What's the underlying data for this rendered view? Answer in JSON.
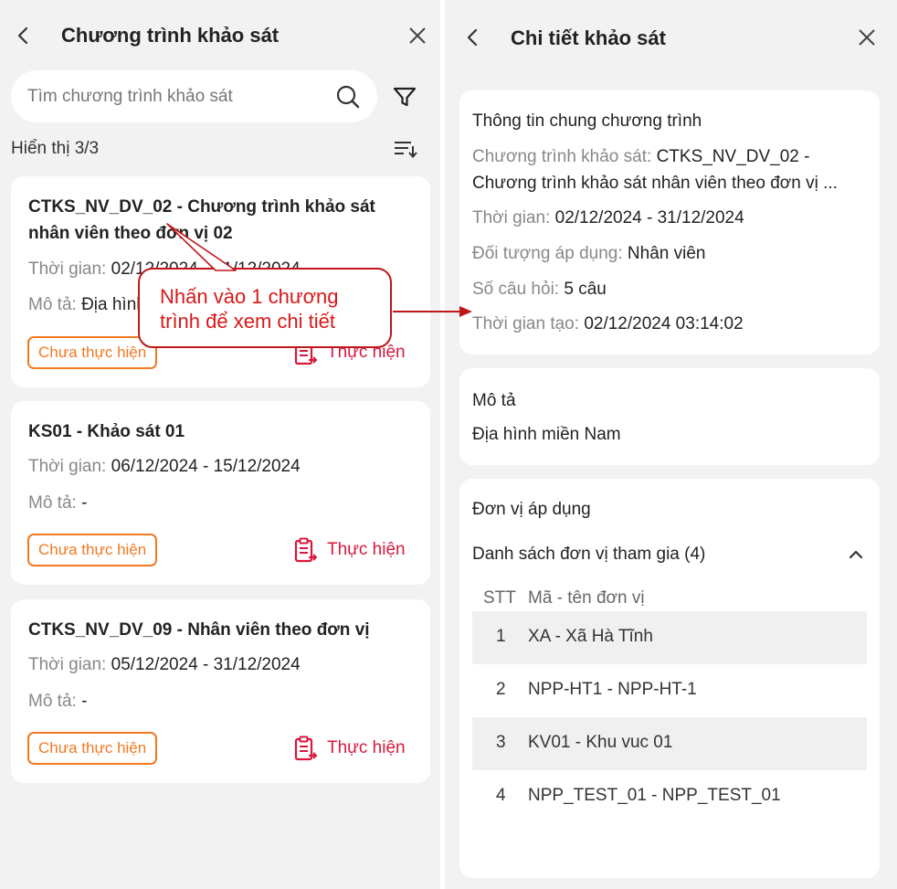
{
  "left": {
    "header": {
      "title": "Chương trình khảo sát"
    },
    "search": {
      "placeholder": "Tìm chương trình khảo sát"
    },
    "count_text": "Hiển thị 3/3",
    "cards": [
      {
        "title": "CTKS_NV_DV_02 - Chương trình khảo sát nhân viên theo đơn vị 02",
        "time_label": "Thời gian: ",
        "time_value": "02/12/2024 - 31/12/2024",
        "desc_label": "Mô tả: ",
        "desc_value": "Địa hình miền Nam",
        "status": "Chưa thực hiện",
        "action": "Thực hiện"
      },
      {
        "title": "KS01 - Khảo sát 01",
        "time_label": "Thời gian: ",
        "time_value": "06/12/2024 - 15/12/2024",
        "desc_label": "Mô tả: ",
        "desc_value": "-",
        "status": "Chưa thực hiện",
        "action": "Thực hiện"
      },
      {
        "title": "CTKS_NV_DV_09 - Nhân viên theo đơn vị",
        "time_label": "Thời gian: ",
        "time_value": "05/12/2024 - 31/12/2024",
        "desc_label": "Mô tả: ",
        "desc_value": "-",
        "status": "Chưa thực hiện",
        "action": "Thực hiện"
      }
    ]
  },
  "callout": {
    "line1": "Nhấn vào 1 chương",
    "line2": "trình để xem chi tiết"
  },
  "right": {
    "header": {
      "title": "Chi tiết khảo sát"
    },
    "general": {
      "title": "Thông tin chung chương trình",
      "program_label": "Chương trình khảo sát: ",
      "program_value_1": "CTKS_NV_DV_02 -",
      "program_value_2": "Chương trình khảo sát nhân viên theo đơn vị ...",
      "time_label": "Thời gian: ",
      "time_value": "02/12/2024 - 31/12/2024",
      "target_label": "Đối tượng áp dụng: ",
      "target_value": "Nhân viên",
      "questions_label": "Số câu hỏi: ",
      "questions_value": "5 câu",
      "created_label": "Thời gian tạo: ",
      "created_value": "02/12/2024 03:14:02"
    },
    "description": {
      "title": "Mô tả",
      "value": "Địa hình miền Nam"
    },
    "units": {
      "title": "Đơn vị áp dụng",
      "list_label": "Danh sách đơn vị tham gia (4)",
      "col_stt": "STT",
      "col_name": "Mã - tên đơn vị",
      "rows": [
        {
          "stt": "1",
          "name": "XA - Xã Hà Tĩnh"
        },
        {
          "stt": "2",
          "name": "NPP-HT1 - NPP-HT-1"
        },
        {
          "stt": "3",
          "name": "KV01 - Khu vuc 01"
        },
        {
          "stt": "4",
          "name": "NPP_TEST_01 - NPP_TEST_01"
        }
      ]
    }
  },
  "colors": {
    "accent_orange": "#f07a22",
    "action_red": "#d7193e",
    "callout_red": "#c0171a",
    "panel_bg": "#f2f2f2"
  },
  "icons": [
    "back-arrow-icon",
    "close-icon",
    "search-icon",
    "filter-icon",
    "sort-icon",
    "clipboard-icon",
    "chevron-up-icon"
  ]
}
